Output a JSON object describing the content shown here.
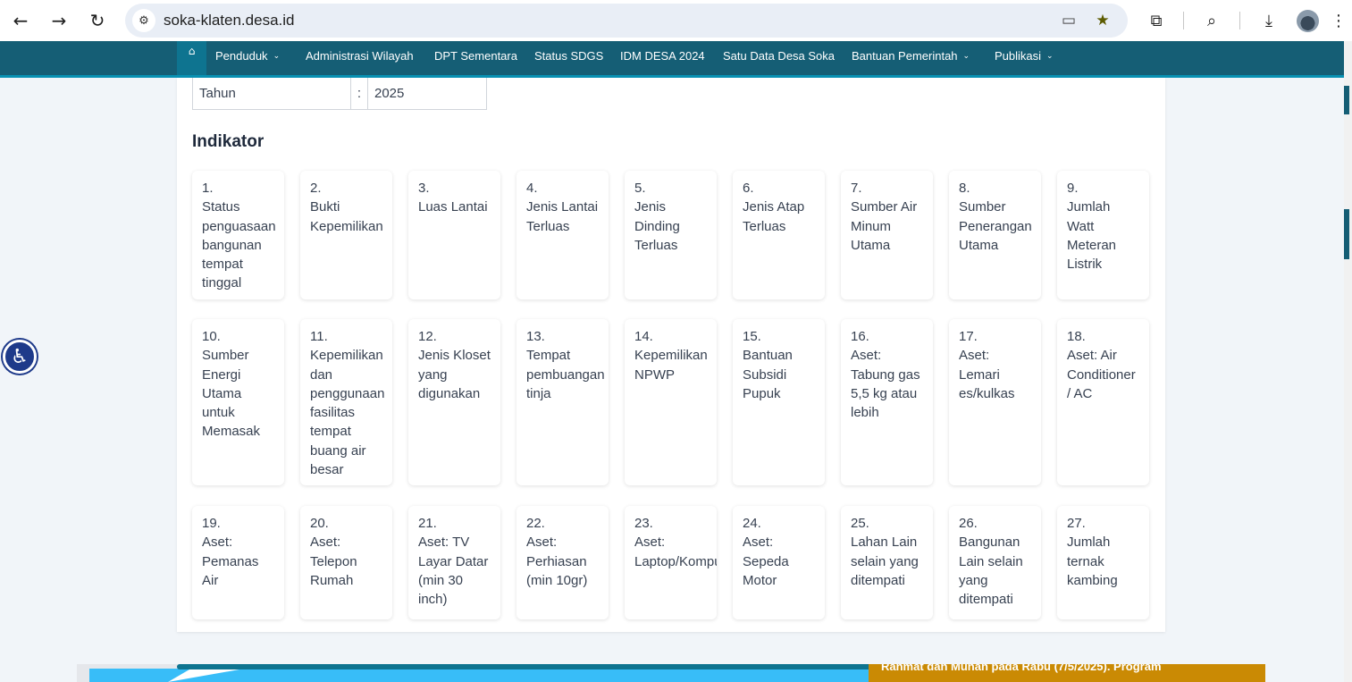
{
  "browser": {
    "url": "soka-klaten.desa.id"
  },
  "site_nav": {
    "items": [
      {
        "label": "Penduduk",
        "dropdown": true
      },
      {
        "label": "Administrasi Wilayah",
        "dropdown": false
      },
      {
        "label": "DPT Sementara",
        "dropdown": false
      },
      {
        "label": "Status SDGS",
        "dropdown": false
      },
      {
        "label": "IDM DESA 2024",
        "dropdown": false
      },
      {
        "label": "Satu Data Desa Soka",
        "dropdown": false
      },
      {
        "label": "Bantuan Pemerintah",
        "dropdown": true
      },
      {
        "label": "Publikasi",
        "dropdown": true
      }
    ]
  },
  "info_table": {
    "label": "Tahun",
    "separator": ":",
    "value": "2025"
  },
  "section_title": "Indikator",
  "indicators": [
    {
      "num": "1.",
      "label": "Status penguasaan bangunan tempat tinggal"
    },
    {
      "num": "2.",
      "label": "Bukti Kepemilikan"
    },
    {
      "num": "3.",
      "label": "Luas Lantai"
    },
    {
      "num": "4.",
      "label": "Jenis Lantai Terluas"
    },
    {
      "num": "5.",
      "label": "Jenis Dinding Terluas"
    },
    {
      "num": "6.",
      "label": "Jenis Atap Terluas"
    },
    {
      "num": "7.",
      "label": "Sumber Air Minum Utama"
    },
    {
      "num": "8.",
      "label": "Sumber Penerangan Utama"
    },
    {
      "num": "9.",
      "label": "Jumlah Watt Meteran Listrik"
    },
    {
      "num": "10.",
      "label": "Sumber Energi Utama untuk Memasak"
    },
    {
      "num": "11.",
      "label": "Kepemilikan dan penggunaan fasilitas tempat buang air besar"
    },
    {
      "num": "12.",
      "label": "Jenis Kloset yang digunakan"
    },
    {
      "num": "13.",
      "label": "Tempat pembuangan tinja"
    },
    {
      "num": "14.",
      "label": "Kepemilikan NPWP"
    },
    {
      "num": "15.",
      "label": "Bantuan Subsidi Pupuk"
    },
    {
      "num": "16.",
      "label": "Aset: Tabung gas 5,5 kg atau lebih"
    },
    {
      "num": "17.",
      "label": "Aset: Lemari es/kulkas"
    },
    {
      "num": "18.",
      "label": "Aset: Air Conditioner / AC"
    },
    {
      "num": "19.",
      "label": "Aset: Pemanas Air"
    },
    {
      "num": "20.",
      "label": "Aset: Telepon Rumah"
    },
    {
      "num": "21.",
      "label": "Aset: TV Layar Datar (min 30 inch)"
    },
    {
      "num": "22.",
      "label": "Aset: Perhiasan (min 10gr)"
    },
    {
      "num": "23.",
      "label": "Aset: Laptop/Komputer"
    },
    {
      "num": "24.",
      "label": "Aset: Sepeda Motor"
    },
    {
      "num": "25.",
      "label": "Lahan Lain selain yang ditempati"
    },
    {
      "num": "26.",
      "label": "Bangunan Lain selain yang ditempati"
    },
    {
      "num": "27.",
      "label": "Jumlah ternak kambing"
    }
  ],
  "ticker_text": "Rahmat dan Munah pada Rabu (7/5/2025). Program",
  "colors": {
    "nav_bg": "#155e75",
    "nav_accent": "#0891b2",
    "page_bg": "#f1f5f9",
    "accessibility": "#1e3a8a",
    "ticker_bg": "#ca8a04"
  },
  "icons": {
    "back": "arrow-left-icon",
    "forward": "arrow-right-icon",
    "reload": "reload-icon",
    "site_info": "site-settings-icon",
    "install": "install-app-icon",
    "bookmark": "star-icon",
    "extensions": "puzzle-icon",
    "lens": "search-page-icon",
    "download": "download-icon",
    "menu": "kebab-menu-icon",
    "home": "home-icon",
    "accessibility": "accessibility-icon"
  }
}
